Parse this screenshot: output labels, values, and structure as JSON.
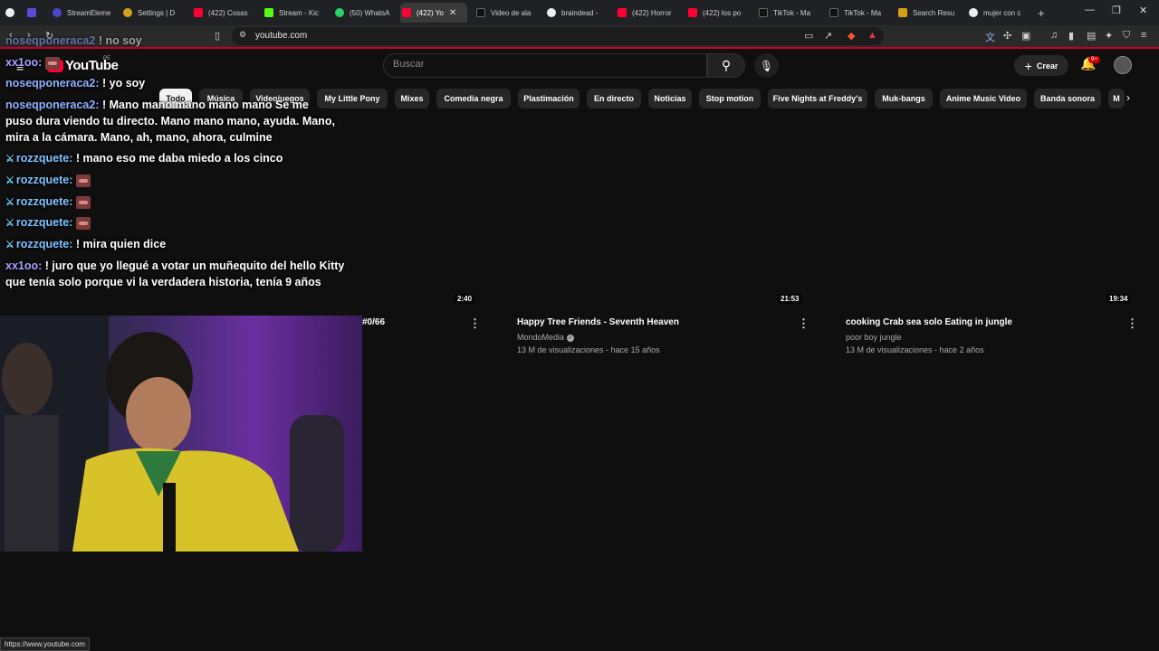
{
  "browser": {
    "tabs": [
      {
        "label": "",
        "color": "#ffffff"
      },
      {
        "label": "",
        "color": "#5b4bdb"
      },
      {
        "label": "StreamEleme",
        "color": "#4b48c9"
      },
      {
        "label": "Settings | D",
        "color": "#d4a018"
      },
      {
        "label": "(422) Cosas",
        "color": "#ff0033"
      },
      {
        "label": "Stream - Kic",
        "color": "#53fc18"
      },
      {
        "label": "(50) WhatsA",
        "color": "#25d366"
      },
      {
        "label": "(422) Yo",
        "color": "#ff0033"
      },
      {
        "label": "Video de ala",
        "color": "#111111"
      },
      {
        "label": "braindead -",
        "color": "#eeeeee"
      },
      {
        "label": "(422) Horror",
        "color": "#ff0033"
      },
      {
        "label": "(422) los po",
        "color": "#ff0033"
      },
      {
        "label": "TikTok - Ma",
        "color": "#111111"
      },
      {
        "label": "TikTok - Ma",
        "color": "#111111"
      },
      {
        "label": "Search Resu",
        "color": "#d4a018"
      },
      {
        "label": "mujer con c",
        "color": "#eeeeee"
      }
    ],
    "new_tab_label": "+",
    "url": "youtube.com",
    "status_url": "https://www.youtube.com"
  },
  "youtube": {
    "logo_text": "YouTube",
    "region": "PE",
    "search_placeholder": "Buscar",
    "create_label": "Crear",
    "notifications_badge": "9+",
    "chips": [
      "Todo",
      "Música",
      "Videojuegos",
      "My Little Pony",
      "Mixes",
      "Comedia negra",
      "Plastimación",
      "En directo",
      "Noticias",
      "Stop motion",
      "Five Nights at Freddy's",
      "Muk-bangs",
      "Anime Music Video",
      "Banda sonora",
      "M"
    ],
    "videos": [
      {
        "duration": "2:40",
        "title": "#0/66",
        "channel": "",
        "meta": ""
      },
      {
        "duration": "21:53",
        "title": "Happy Tree Friends - Seventh Heaven",
        "channel": "MondoMedia",
        "verified": true,
        "meta": "13 M de visualizaciones - hace 15 años"
      },
      {
        "duration": "19:34",
        "title": "cooking Crab sea solo Eating in jungle",
        "channel": "poor boy jungle",
        "meta": "13 M de visualizaciones - hace 2 años"
      }
    ]
  },
  "chat": {
    "messages": [
      {
        "user": "noseqponeraca2",
        "text": "! no soy"
      },
      {
        "user": "xx1oo:",
        "text": ""
      },
      {
        "user": "noseqponeraca2:",
        "text": "! yo soy"
      },
      {
        "user": "noseqponeraca2:",
        "text_lines": [
          "! Mano mano mano mano mano Se me",
          "puso dura viendo tu directo. Mano mano mano, ayuda. Mano,",
          "mira a la cámara. Mano, ah, mano, ahora, culmine"
        ]
      },
      {
        "user": "rozzquete:",
        "text": "! mano eso me daba miedo a los cinco"
      },
      {
        "user": "rozzquete:",
        "text": ""
      },
      {
        "user": "rozzquete:",
        "text": ""
      },
      {
        "user": "rozzquete:",
        "text": ""
      },
      {
        "user": "rozzquete:",
        "text": "! mira quien dice"
      },
      {
        "user": "xx1oo:",
        "text_lines": [
          "! juro que yo llegué a votar un muñequito del hello Kitty",
          "que tenía solo porque vi la verdadera historia, tenía 9 años"
        ]
      }
    ]
  }
}
